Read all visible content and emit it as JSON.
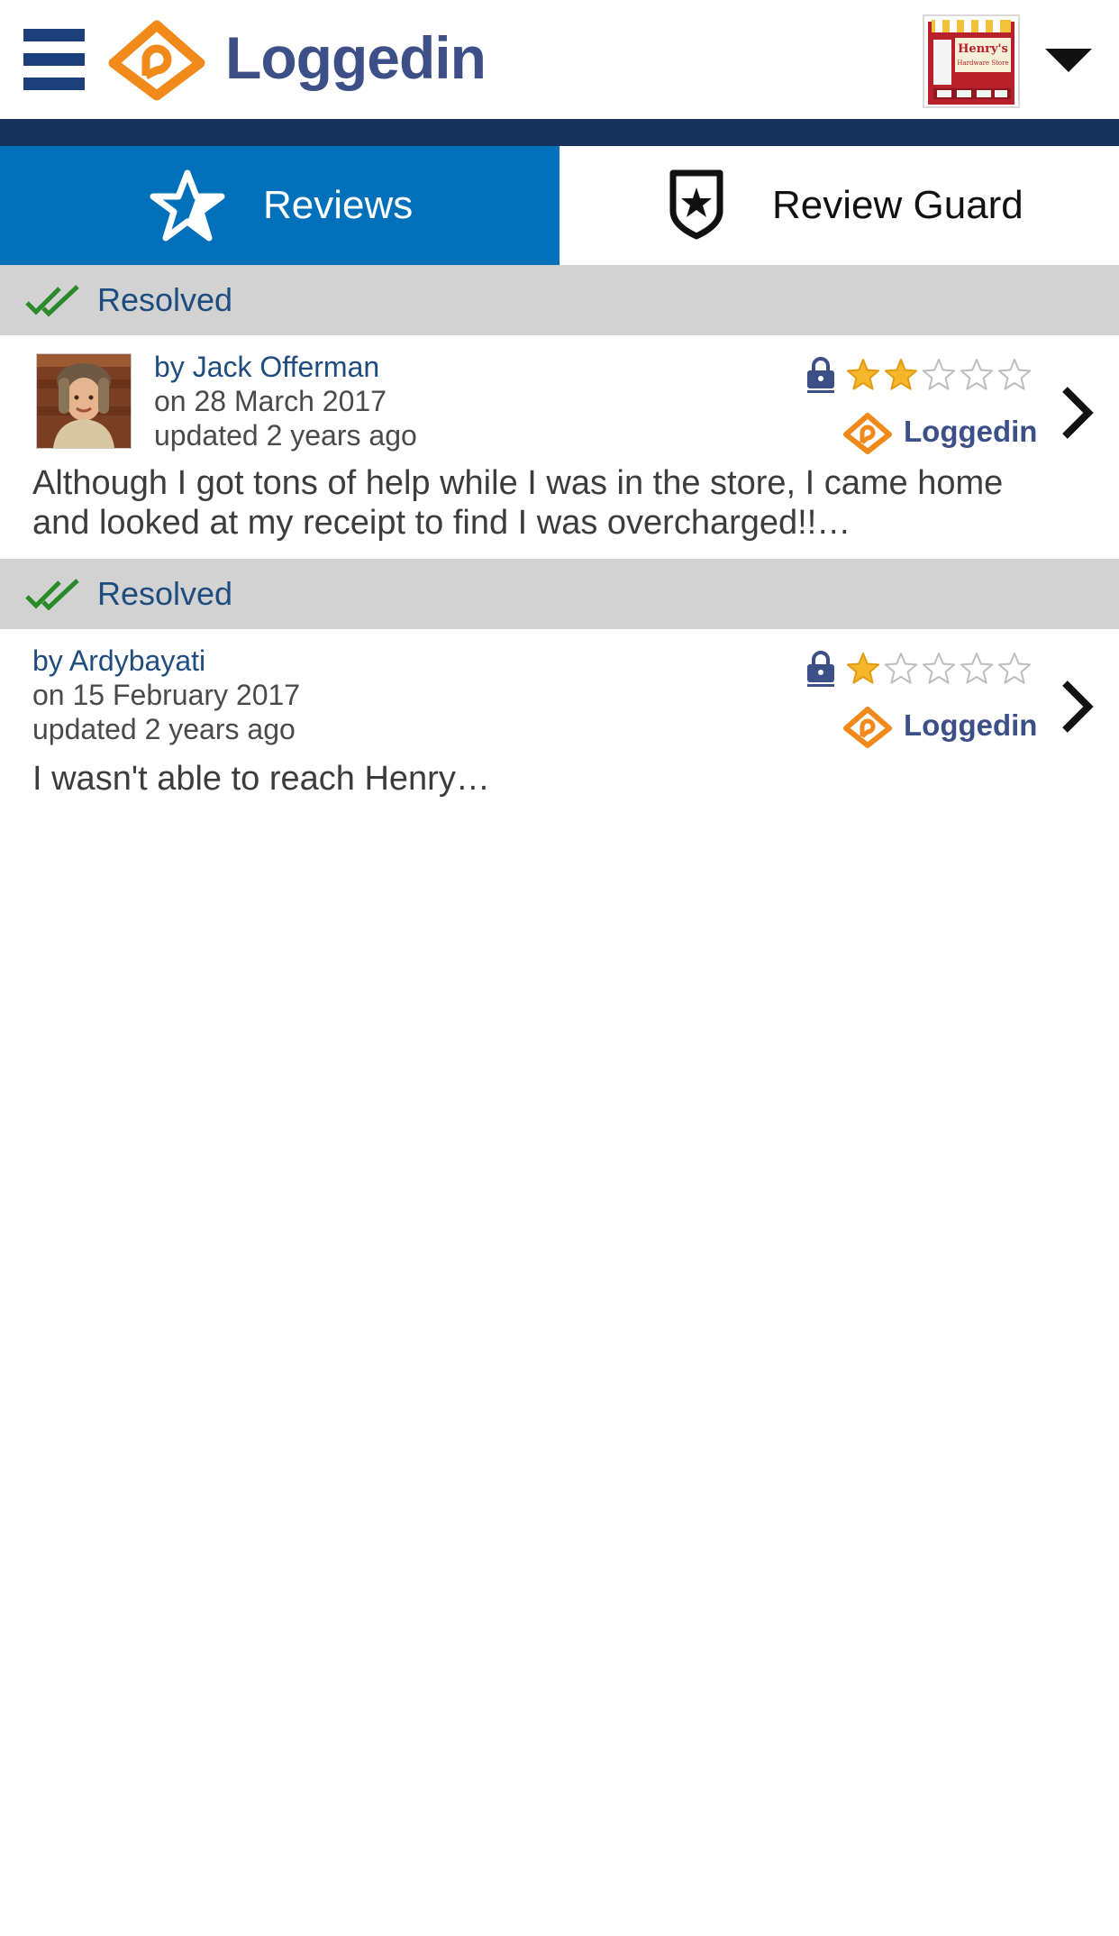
{
  "header": {
    "brand_name": "Loggedin",
    "store_thumbnail": {
      "line1": "Henry's",
      "line2": "Hardware Store"
    },
    "colors": {
      "brand_blue": "#3c4f86",
      "brand_orange": "#f18a1a",
      "navy": "#17305e"
    }
  },
  "tabs": [
    {
      "label": "Reviews",
      "icon": "star-icon",
      "active": true
    },
    {
      "label": "Review Guard",
      "icon": "shield-star-icon",
      "active": false
    }
  ],
  "reviews": [
    {
      "status": "Resolved",
      "author": "by Jack Offerman",
      "date": "on 28 March 2017",
      "updated": "updated 2 years ago",
      "rating": 2,
      "max_rating": 5,
      "source": "Loggedin",
      "has_avatar": true,
      "text": "Although I got tons of help while I was in the store, I came home and looked at my receipt to find I was overcharged!!…"
    },
    {
      "status": "Resolved",
      "author": "by Ardybayati",
      "date": "on 15 February 2017",
      "updated": "updated 2 years ago",
      "rating": 1,
      "max_rating": 5,
      "source": "Loggedin",
      "has_avatar": false,
      "text": "I wasn't able to reach Henry…"
    }
  ]
}
